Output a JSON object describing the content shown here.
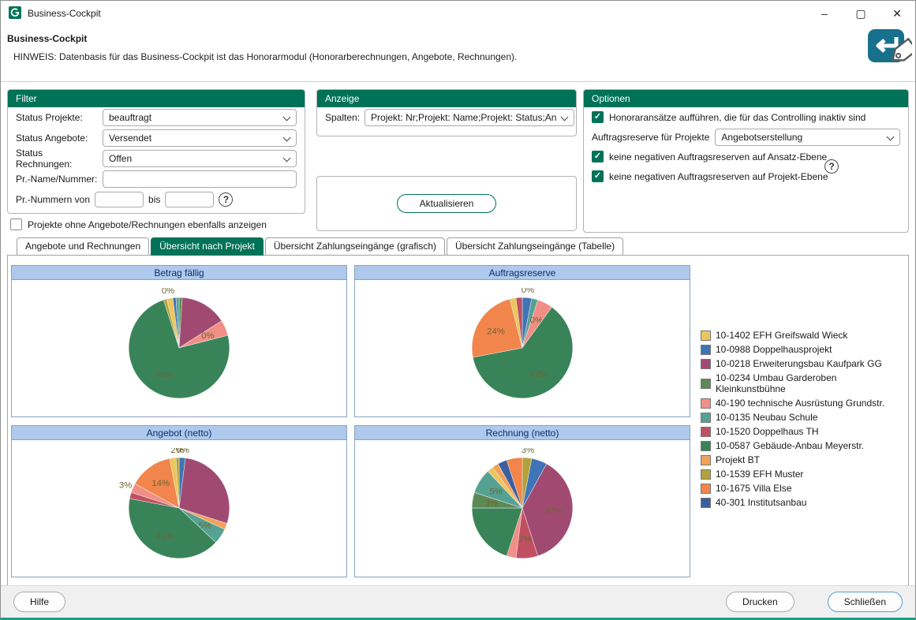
{
  "window": {
    "title": "Business-Cockpit",
    "controls": {
      "minimize": "–",
      "maximize": "▢",
      "close": "✕"
    }
  },
  "icons": {
    "help": "?"
  },
  "header": {
    "title": "Business-Cockpit",
    "hint": "HINWEIS: Datenbasis für das Business-Cockpit ist das Honorarmodul (Honorarberechnungen, Angebote, Rechnungen)."
  },
  "filter": {
    "title": "Filter",
    "fields": [
      {
        "label": "Status Projekte:",
        "value": "beauftragt"
      },
      {
        "label": "Status Angebote:",
        "value": "Versendet"
      },
      {
        "label": "Status Rechnungen:",
        "value": "Offen"
      },
      {
        "label": "Pr.-Name/Nummer:",
        "value": ""
      }
    ],
    "range": {
      "label": "Pr.-Nummern von",
      "bis": "bis",
      "von_value": "",
      "bis_value": ""
    },
    "checkbox": {
      "label": "Projekte ohne Angebote/Rechnungen ebenfalls anzeigen",
      "checked": false
    }
  },
  "anzeige": {
    "title": "Anzeige",
    "spalten_label": "Spalten:",
    "spalten_value": "Projekt: Nr;Projekt: Name;Projekt: Status;An",
    "refresh_label": "Aktualisieren"
  },
  "optionen": {
    "title": "Optionen",
    "checkboxes": [
      {
        "label": "Honoraransätze aufführen, die für das Controlling inaktiv sind",
        "checked": true
      },
      {
        "label": "keine negativen Auftragsreserven auf Ansatz-Ebene",
        "checked": true
      },
      {
        "label": "keine negativen Auftragsreserven auf Projekt-Ebene",
        "checked": true
      }
    ],
    "reserve_label": "Auftragsreserve für Projekte",
    "reserve_value": "Angebotserstellung"
  },
  "tabs": [
    {
      "label": "Angebote und Rechnungen",
      "active": false
    },
    {
      "label": "Übersicht nach Projekt",
      "active": true
    },
    {
      "label": "Übersicht Zahlungseingänge (grafisch)",
      "active": false
    },
    {
      "label": "Übersicht Zahlungseingänge (Tabelle)",
      "active": false
    }
  ],
  "legend": [
    {
      "label": "10-1402 EFH Greifswald Wieck",
      "color": "#EDC65B"
    },
    {
      "label": "10-0988 Doppelhausprojekt",
      "color": "#3F74B6"
    },
    {
      "label": "10-0218 Erweiterungsbau Kaufpark GG",
      "color": "#A04A72"
    },
    {
      "label": "10-0234 Umbau Garderoben Kleinkunstbühne",
      "color": "#5C8A54"
    },
    {
      "label": "40-190 technische Ausrüstung Grundstr.",
      "color": "#F28E85"
    },
    {
      "label": "10-0135 Neubau Schule",
      "color": "#55A193"
    },
    {
      "label": "10-1520 Doppelhaus TH",
      "color": "#C14F62"
    },
    {
      "label": "10-0587 Gebäude-Anbau Meyerstr.",
      "color": "#388458"
    },
    {
      "label": "Projekt BT",
      "color": "#F2A15B"
    },
    {
      "label": "10-1539 EFH Muster",
      "color": "#B3A23B"
    },
    {
      "label": "10-1675 Villa Else",
      "color": "#F2854B"
    },
    {
      "label": "40-301 Institutsanbau",
      "color": "#3C5FA0"
    }
  ],
  "chart_data": [
    {
      "type": "pie",
      "title": "Betrag fällig",
      "slices": [
        {
          "project": 3,
          "value": 1
        },
        {
          "project": 2,
          "value": 15
        },
        {
          "project": 4,
          "value": 5,
          "label": "0%"
        },
        {
          "project": 7,
          "value": 74,
          "label": "74%"
        },
        {
          "project": 9,
          "value": 1
        },
        {
          "project": 0,
          "value": 2,
          "label": "0%"
        },
        {
          "project": 1,
          "value": 1
        },
        {
          "project": 5,
          "value": 1
        }
      ]
    },
    {
      "type": "pie",
      "title": "Auftragsreserve",
      "slices": [
        {
          "project": 1,
          "value": 3,
          "label": "0%"
        },
        {
          "project": 5,
          "value": 2
        },
        {
          "project": 4,
          "value": 5,
          "label": "0%"
        },
        {
          "project": 7,
          "value": 62,
          "label": "62%"
        },
        {
          "project": 10,
          "value": 24,
          "label": "24%"
        },
        {
          "project": 0,
          "value": 2
        },
        {
          "project": 6,
          "value": 2
        }
      ]
    },
    {
      "type": "pie",
      "title": "Angebot (netto)",
      "slices": [
        {
          "project": 1,
          "value": 2,
          "label": "0%"
        },
        {
          "project": 2,
          "value": 28
        },
        {
          "project": 8,
          "value": 2
        },
        {
          "project": 5,
          "value": 5,
          "label": "5%"
        },
        {
          "project": 7,
          "value": 41,
          "label": "41%"
        },
        {
          "project": 6,
          "value": 2
        },
        {
          "project": 4,
          "value": 3,
          "label": "3%"
        },
        {
          "project": 10,
          "value": 14,
          "label": "14%"
        },
        {
          "project": 0,
          "value": 2
        },
        {
          "project": 9,
          "value": 1,
          "label": "2%"
        }
      ]
    },
    {
      "type": "pie",
      "title": "Rechnung (netto)",
      "slices": [
        {
          "project": 9,
          "value": 3,
          "label": "3%"
        },
        {
          "project": 1,
          "value": 5
        },
        {
          "project": 2,
          "value": 37,
          "label": "37%"
        },
        {
          "project": 6,
          "value": 7,
          "label": "7%"
        },
        {
          "project": 4,
          "value": 3
        },
        {
          "project": 7,
          "value": 20
        },
        {
          "project": 3,
          "value": 5,
          "label": "3%"
        },
        {
          "project": 5,
          "value": 8,
          "label": "5%"
        },
        {
          "project": 0,
          "value": 2
        },
        {
          "project": 8,
          "value": 2
        },
        {
          "project": 11,
          "value": 3
        },
        {
          "project": 10,
          "value": 5
        }
      ]
    }
  ],
  "footer": {
    "hilfe": "Hilfe",
    "drucken": "Drucken",
    "schliessen": "Schließen"
  },
  "theme": {
    "green": "#007257",
    "chart_header_bg": "#AEC9EB",
    "chart_header_text": "#0A2E6E",
    "accent_teal": "#17A089"
  }
}
